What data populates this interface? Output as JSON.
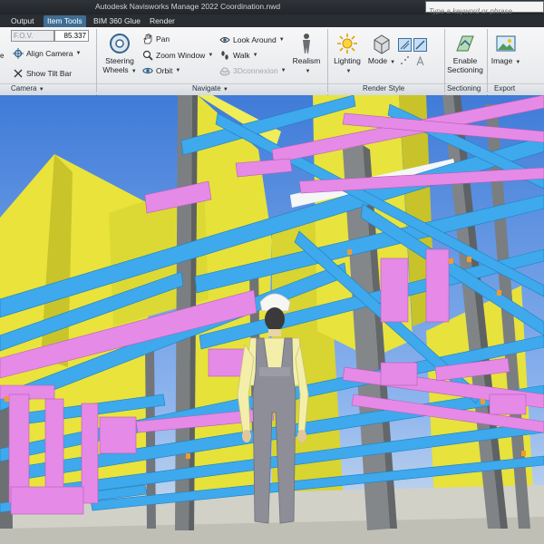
{
  "window": {
    "title": "Autodesk Navisworks Manage 2022     Coordination.nwd",
    "search_placeholder": "Type a keyword or phrase"
  },
  "tabs": [
    {
      "label": "Output"
    },
    {
      "label": "Item Tools",
      "active": true
    },
    {
      "label": "BIM 360 Glue"
    },
    {
      "label": "Render"
    }
  ],
  "camera_panel": {
    "fov_label": "F.O.V.",
    "fov_value": "85.337",
    "align_camera": "Align Camera",
    "show_tilt_bar": "Show Tilt Bar",
    "title": "Camera"
  },
  "navigate_panel": {
    "steering_wheels_line1": "Steering",
    "steering_wheels_line2": "Wheels",
    "pan": "Pan",
    "zoom_window": "Zoom Window",
    "orbit": "Orbit",
    "look_around": "Look Around",
    "walk": "Walk",
    "connexion": "3Dconnexion",
    "realism": "Realism",
    "title": "Navigate"
  },
  "render_style_panel": {
    "lighting": "Lighting",
    "mode": "Mode",
    "title": "Render Style"
  },
  "sectioning_panel": {
    "enable_line1": "Enable",
    "enable_line2": "Sectioning",
    "title": "Sectioning"
  },
  "export_panel": {
    "image": "Image",
    "title": "Export"
  },
  "icons": {
    "search": "search-icon",
    "align_camera": "align-camera-icon",
    "tilt_bar": "tilt-bar-icon",
    "steering_wheels": "steering-wheel-icon",
    "pan": "hand-icon",
    "zoom_window": "magnifier-icon",
    "orbit": "orbit-icon",
    "look_around": "eye-icon",
    "walk": "footprints-icon",
    "connexion": "3d-mouse-icon",
    "realism": "person-icon",
    "lighting": "sun-icon",
    "mode": "cube-icon",
    "enable_sectioning": "section-plane-icon",
    "image": "picture-icon"
  },
  "colors": {
    "ribbon_bg": "#eceef0",
    "active_tab": "#3f6e94",
    "sky": "#4f8ee0",
    "steel_beams": "#3fa7ea",
    "ducts": "#e88ee8",
    "walls": "#e6e238",
    "columns": "#7d8184",
    "worker_shirt": "#f3efab",
    "worker_overalls": "#909099",
    "floor": "#c8c8c0"
  }
}
